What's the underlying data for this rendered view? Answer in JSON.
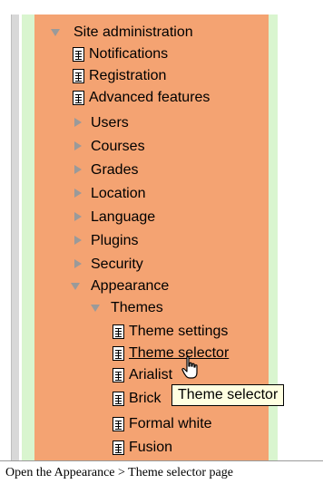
{
  "tree": {
    "site_admin": "Site administration",
    "notifications": "Notifications",
    "registration": "Registration",
    "advanced_features": "Advanced features",
    "users": "Users",
    "courses": "Courses",
    "grades": "Grades",
    "location": "Location",
    "language": "Language",
    "plugins": "Plugins",
    "security": "Security",
    "appearance": "Appearance",
    "themes": "Themes",
    "theme_settings": "Theme settings",
    "theme_selector": "Theme selector",
    "arialist": "Arialist",
    "brick": "Brick",
    "formal_white": "Formal white",
    "fusion": "Fusion"
  },
  "tooltip": "Theme selector",
  "caption": "Open the Appearance > Theme selector page",
  "colors": {
    "panel": "#f4a372",
    "green": "#d9f5cf",
    "tooltip_bg": "#ffffe1"
  }
}
